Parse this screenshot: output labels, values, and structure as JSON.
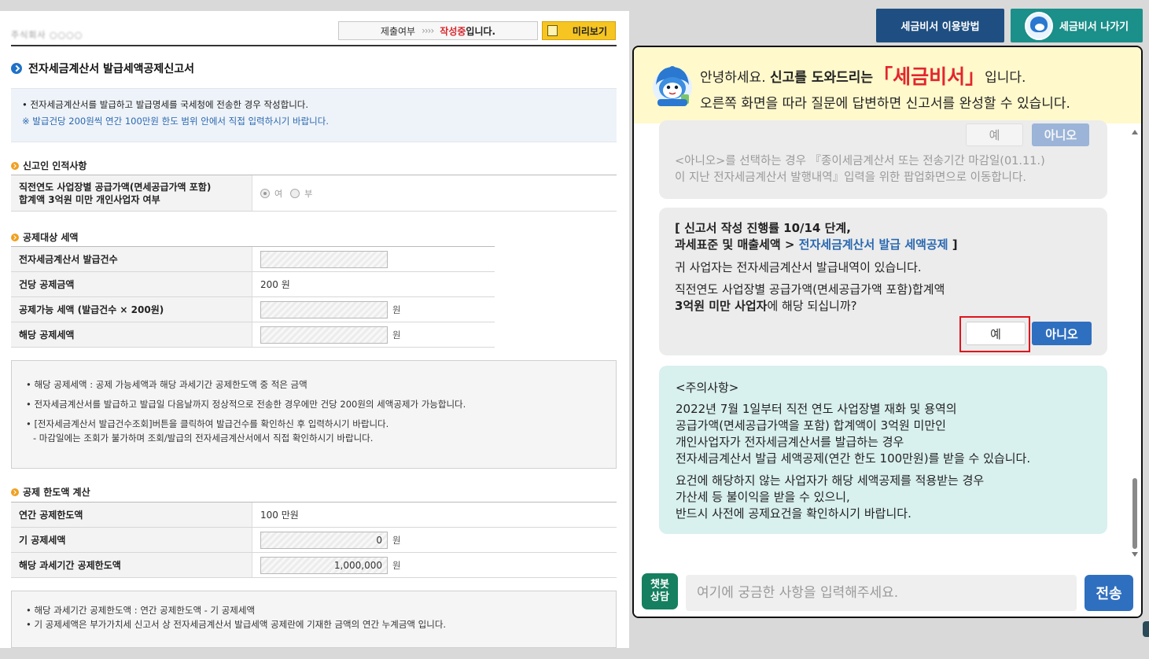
{
  "form": {
    "blurred_name": "주식회사 ○○○○",
    "status_label": "제출여부",
    "status_arrows": "››››",
    "status_value": "작성중",
    "status_suffix": "입니다.",
    "preview_label": "미리보기",
    "title": "전자세금계산서 발급세액공제신고서",
    "intro_line1": "• 전자세금계산서를 발급하고 발급명세를 국세청에 전송한 경우 작성합니다.",
    "intro_line2": "※ 발급건당 200원씩 연간 100만원 한도 범위 안에서 직접 입력하시기 바랍니다.",
    "section_reporter": "신고인 인적사항",
    "reporter_row_label1": "직전연도 사업장별 공급가액(면세공급가액 포함)",
    "reporter_row_label2": "합계액 3억원 미만 개인사업자 여부",
    "radio_yes": "여",
    "radio_no": "부",
    "section_target": "공제대상 세액",
    "row_issue_count": "전자세금계산서 발급건수",
    "row_per_amount": "건당 공제금액",
    "per_amount_value": "200 원",
    "row_possible": "공제가능 세액 (발급건수 × 200원)",
    "row_applicable": "해당 공제세액",
    "unit_won": "원",
    "note1_line1": "• 해당 공제세액 : 공제 가능세액과 해당 과세기간 공제한도액 중 적은 금액",
    "note1_line2": "• 전자세금계산서를 발급하고 발급일 다음날까지 정상적으로 전송한 경우에만 건당 200원의 세액공제가 가능합니다.",
    "note1_line3": "• [전자세금계산서 발급건수조회]버튼을 클릭하여 발급건수를 확인하신 후 입력하시기 바랍니다.",
    "note1_line4": "- 마감일에는 조회가 불가하며 조회/발급의 전자세금계산서에서 직접 확인하시기 바랍니다.",
    "section_limit": "공제 한도액 계산",
    "row_annual_limit": "연간 공제한도액",
    "annual_limit_value": "100 만원",
    "row_prior_deduction": "기 공제세액",
    "prior_deduction_value": "0",
    "row_period_limit": "해당 과세기간 공제한도액",
    "period_limit_value": "1,000,000",
    "note2_line1": "• 해당 과세기간 공제한도액 : 연간 공제한도액 - 기 공제세액",
    "note2_line2": "• 기 공제세액은 부가가치세 신고서 상 전자세금계산서 발급세액 공제란에 기재한 금액의 연간 누계금액 입니다."
  },
  "top_buttons": {
    "howto": "세금비서 이용방법",
    "exit": "세금비서 나가기"
  },
  "chat": {
    "greet_prefix": "안녕하세요.",
    "greet_strong": "신고를 도와드리는",
    "greet_brand": "「세금비서」",
    "greet_suffix": "입니다.",
    "greet_line2": "오른쪽 화면을 따라 질문에 답변하면 신고서를 완성할 수 있습니다.",
    "prev_yes": "예",
    "prev_no": "아니오",
    "prev_note_line1": "<아니오>를 선택하는 경우 『종이세금계산서 또는 전송기간 마감일(01.11.)",
    "prev_note_line2": "이 지난 전자세금계산서 발행내역』입력을 위한 팝업화면으로 이동합니다.",
    "progress_line1": "[ 신고서 작성 진행률 10/14 단계,",
    "progress_line2_prefix": "과세표준 및 매출세액 > ",
    "progress_line2_link": "전자세금계산서 발급 세액공제",
    "progress_line2_suffix": " ]",
    "q_line1": "귀 사업자는 전자세금계산서 발급내역이 있습니다.",
    "q_line2": "직전연도 사업장별 공급가액(면세공급가액 포함)합계액",
    "q_line3_bold": "3억원 미만 사업자",
    "q_line3_rest": "에 해당 되십니까?",
    "yes": "예",
    "no": "아니오",
    "caution_title": "<주의사항>",
    "caution_line1": "2022년 7월 1일부터 직전 연도 사업장별 재화 및 용역의",
    "caution_line2": "공급가액(면세공급가액을 포함) 합계액이 3억원 미만인",
    "caution_line3": "개인사업자가 전자세금계산서를 발급하는 경우",
    "caution_line4": "전자세금계산서 발급 세액공제(연간 한도 100만원)를 받을 수 있습니다.",
    "caution_line5": "요건에 해당하지 않는 사업자가 해당 세액공제를 적용받는 경우",
    "caution_line6": "가산세 등 불이익을 받을 수 있으니,",
    "caution_line7": "반드시 사전에 공제요건을 확인하시기 바랍니다.",
    "badge_line1": "챗봇",
    "badge_line2": "상담",
    "input_placeholder": "여기에 궁금한 사항을 입력해주세요.",
    "send": "전송"
  },
  "colors": {
    "brand_red": "#e3262d",
    "primary_blue": "#2f6fbf",
    "header_yellow": "#fff9cc",
    "caution_teal": "#d8f0ee",
    "chatbot_green": "#157f5f"
  }
}
